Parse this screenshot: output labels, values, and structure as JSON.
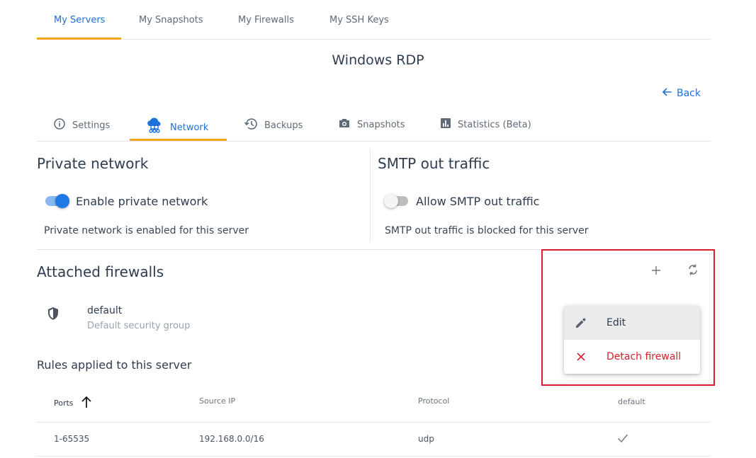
{
  "top_tabs": [
    {
      "label": "My Servers",
      "active": true
    },
    {
      "label": "My Snapshots",
      "active": false
    },
    {
      "label": "My Firewalls",
      "active": false
    },
    {
      "label": "My SSH Keys",
      "active": false
    }
  ],
  "page_title": "Windows RDP",
  "back_label": "Back",
  "sub_tabs": [
    {
      "label": "Settings",
      "icon": "info-icon",
      "active": false
    },
    {
      "label": "Network",
      "icon": "network-cloud-icon",
      "active": true
    },
    {
      "label": "Backups",
      "icon": "history-icon",
      "active": false
    },
    {
      "label": "Snapshots",
      "icon": "camera-icon",
      "active": false
    },
    {
      "label": "Statistics (Beta)",
      "icon": "bar-chart-icon",
      "active": false
    }
  ],
  "private_network": {
    "title": "Private network",
    "toggle_label": "Enable private network",
    "enabled": true,
    "description": "Private network is enabled for this server"
  },
  "smtp": {
    "title": "SMTP out traffic",
    "toggle_label": "Allow SMTP out traffic",
    "enabled": false,
    "description": "SMTP out traffic is blocked for this server"
  },
  "firewalls": {
    "title": "Attached firewalls",
    "add_icon": "plus-icon",
    "refresh_icon": "refresh-icon",
    "items": [
      {
        "name": "default",
        "description": "Default security group",
        "icon": "shield-icon"
      }
    ]
  },
  "context_menu": {
    "items": [
      {
        "label": "Edit",
        "icon": "pencil-icon",
        "color": "#2e3d4f"
      },
      {
        "label": "Detach firewall",
        "icon": "close-icon",
        "color": "#d6202b"
      }
    ]
  },
  "rules": {
    "title": "Rules applied to this server",
    "columns": [
      "Ports",
      "Source IP",
      "Protocol",
      "default"
    ],
    "rows": [
      {
        "ports": "1-65535",
        "source_ip": "192.168.0.0/16",
        "protocol": "udp",
        "default": true
      }
    ]
  },
  "colors": {
    "accent": "#1e6fd9",
    "tab_underline": "#f4a51c",
    "danger": "#d6202b",
    "highlight_box": "#d6202b"
  }
}
